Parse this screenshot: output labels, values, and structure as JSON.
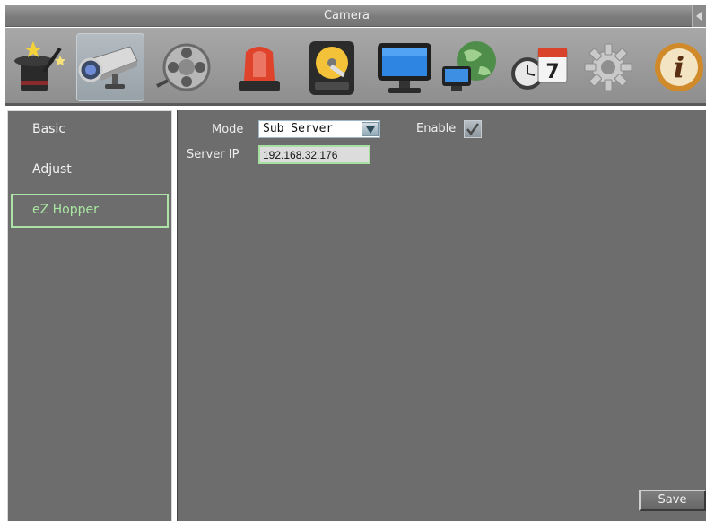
{
  "window": {
    "title": "Camera"
  },
  "toolbar": {
    "icons": [
      {
        "name": "wizard-hat-icon"
      },
      {
        "name": "camera-icon",
        "selected": true
      },
      {
        "name": "film-reel-icon"
      },
      {
        "name": "alarm-siren-icon"
      },
      {
        "name": "hard-disk-icon"
      },
      {
        "name": "monitor-icon"
      },
      {
        "name": "network-globe-icon"
      },
      {
        "name": "clock-calendar-icon",
        "calendar_day": "7"
      },
      {
        "name": "gear-icon"
      },
      {
        "name": "info-icon",
        "glyph": "i"
      }
    ]
  },
  "sidebar": {
    "items": [
      {
        "label": "Basic"
      },
      {
        "label": "Adjust"
      },
      {
        "label": "eZ Hopper",
        "active": true
      }
    ]
  },
  "form": {
    "mode_label": "Mode",
    "mode_value": "Sub Server",
    "enable_label": "Enable",
    "enable_checked": true,
    "server_ip_label": "Server IP",
    "server_ip_value": "192.168.32.176"
  },
  "actions": {
    "save_label": "Save"
  },
  "colors": {
    "panel_bg": "#6d6d6d",
    "highlight_green": "#a8e6a1",
    "titlebar_bg": "#7c7c7c"
  }
}
